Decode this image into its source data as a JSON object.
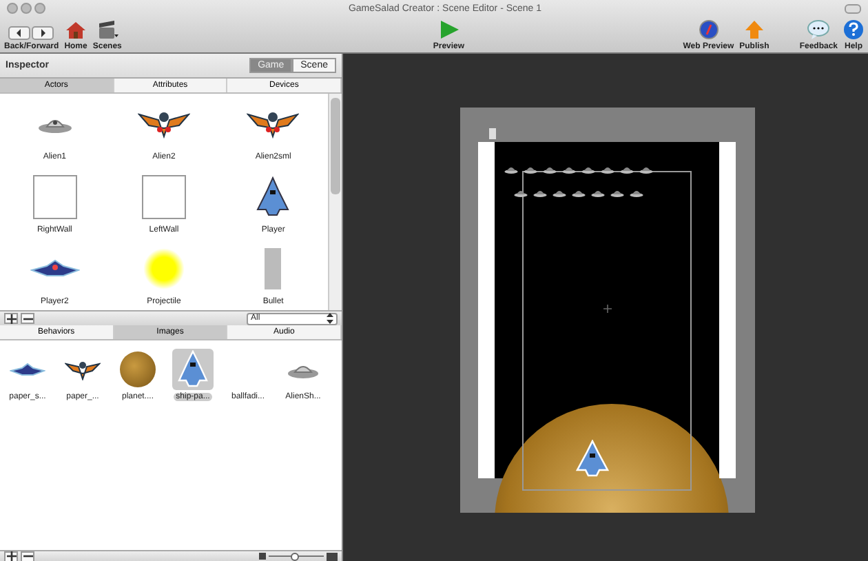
{
  "window": {
    "title": "GameSalad Creator : Scene Editor - Scene 1"
  },
  "toolbar": {
    "left": [
      {
        "label": "Back/Forward",
        "kind": "backforward"
      },
      {
        "label": "Home",
        "kind": "home"
      },
      {
        "label": "Scenes",
        "kind": "scenes"
      }
    ],
    "center": {
      "label": "Preview",
      "kind": "preview"
    },
    "right": [
      {
        "label": "Web Preview",
        "kind": "web"
      },
      {
        "label": "Publish",
        "kind": "publish"
      },
      {
        "label": "Feedback",
        "kind": "feedback"
      },
      {
        "label": "Help",
        "kind": "help"
      }
    ]
  },
  "inspector": {
    "title": "Inspector",
    "mode_toggle": [
      {
        "label": "Game",
        "selected": true
      },
      {
        "label": "Scene",
        "selected": false
      }
    ],
    "tabs": [
      {
        "label": "Actors",
        "selected": true
      },
      {
        "label": "Attributes",
        "selected": false
      },
      {
        "label": "Devices",
        "selected": false
      }
    ],
    "actors": [
      {
        "name": "Alien1",
        "kind": "ufo"
      },
      {
        "name": "Alien2",
        "kind": "winged"
      },
      {
        "name": "Alien2sml",
        "kind": "winged"
      },
      {
        "name": "RightWall",
        "kind": "wall"
      },
      {
        "name": "LeftWall",
        "kind": "wall"
      },
      {
        "name": "Player",
        "kind": "ship"
      },
      {
        "name": "Player2",
        "kind": "flat-ship"
      },
      {
        "name": "Projectile",
        "kind": "glow"
      },
      {
        "name": "Bullet",
        "kind": "bar"
      }
    ],
    "filter": {
      "value": "All"
    }
  },
  "library": {
    "tabs": [
      {
        "label": "Behaviors",
        "selected": false
      },
      {
        "label": "Images",
        "selected": true
      },
      {
        "label": "Audio",
        "selected": false
      }
    ],
    "images": [
      {
        "name": "paper_s...",
        "kind": "flat-ship",
        "selected": false
      },
      {
        "name": "paper_...",
        "kind": "winged",
        "selected": false
      },
      {
        "name": "planet....",
        "kind": "planet",
        "selected": false
      },
      {
        "name": "ship-pa...",
        "kind": "ship",
        "selected": true
      },
      {
        "name": "ballfadi...",
        "kind": "none",
        "selected": false
      },
      {
        "name": "AlienSh...",
        "kind": "ufo",
        "selected": false
      }
    ],
    "zoom": {
      "level": 0.45
    }
  }
}
